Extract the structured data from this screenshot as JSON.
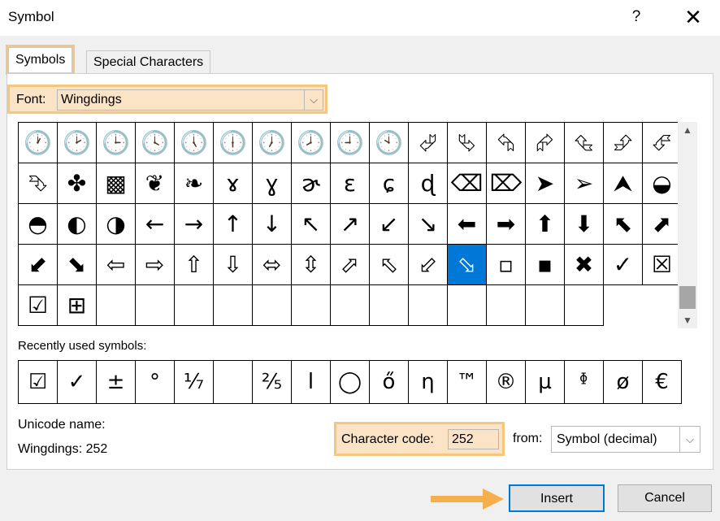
{
  "window": {
    "title": "Symbol",
    "help": "?",
    "close": "✕"
  },
  "tabs": [
    {
      "label": "Symbols",
      "active": true
    },
    {
      "label": "Special Characters",
      "active": false
    }
  ],
  "font": {
    "label": "Font:",
    "value": "Wingdings"
  },
  "symbol_grid": {
    "selected_index": 62,
    "cells": [
      "🕐",
      "🕑",
      "🕒",
      "🕓",
      "🕔",
      "🕕",
      "🕖",
      "🕗",
      "🕘",
      "🕙",
      "⮰",
      "⮱",
      "⮲",
      "⮳",
      "⮴",
      "⮵",
      "⮶",
      "⮷",
      "✤",
      "▩",
      "❦",
      "❧",
      "ɤ",
      "ɣ",
      "ɚ",
      "ɛ",
      "ɕ",
      "ɖ",
      "⌫",
      "⌦",
      "➤",
      "➢",
      "⮝",
      "◒",
      "◓",
      "◐",
      "◑",
      "←",
      "→",
      "↑",
      "↓",
      "↖",
      "↗",
      "↙",
      "↘",
      "⬅",
      "➡",
      "⬆",
      "⬇",
      "⬉",
      "⬈",
      "⬋",
      "⬊",
      "⇦",
      "⇨",
      "⇧",
      "⇩",
      "⬄",
      "⇳",
      "⬀",
      "⬁",
      "⬃",
      "⬂",
      "▫",
      "▪",
      "✖",
      "✓",
      "☒",
      "☑",
      "⊞",
      "",
      "",
      "",
      "",
      "",
      "",
      "",
      "",
      "",
      "",
      "",
      "",
      ""
    ]
  },
  "recent": {
    "label": "Recently used symbols:",
    "cells": [
      "☑",
      "✓",
      "±",
      "°",
      "⅐",
      "",
      "⅖",
      "ا",
      "◯",
      "ő",
      "η",
      "™",
      "®",
      "µ",
      "ᶲ",
      "ø",
      "€"
    ]
  },
  "unicode": {
    "label": "Unicode name:",
    "value": "Wingdings: 252"
  },
  "character_code": {
    "label": "Character code:",
    "value": "252"
  },
  "from": {
    "label": "from:",
    "value": "Symbol (decimal)"
  },
  "buttons": {
    "insert": "Insert",
    "cancel": "Cancel"
  },
  "colors": {
    "highlight": "#f5c77e",
    "accent": "#0078d7",
    "arrow": "#f5b04d"
  }
}
